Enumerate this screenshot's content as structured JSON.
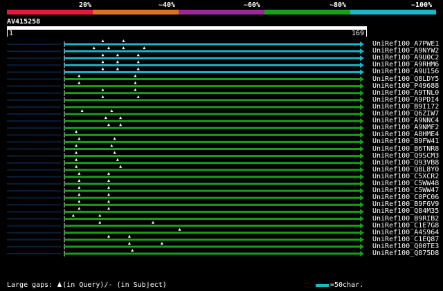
{
  "legend": {
    "segments": [
      {
        "label": "20%",
        "color": "#e8173c"
      },
      {
        "label": "~40%",
        "color": "#e07020"
      },
      {
        "label": "~60%",
        "color": "#9a2898"
      },
      {
        "label": "~80%",
        "color": "#18a018"
      },
      {
        "label": "~100%",
        "color": "#18b8c8"
      }
    ]
  },
  "query": {
    "id": "AV415258",
    "start": "1",
    "end": "169"
  },
  "hits": [
    {
      "name": "UniRef100_A7PWE1",
      "color": "#18b8c8",
      "markers": [
        0.13,
        0.2
      ]
    },
    {
      "name": "UniRef100_A9NYW2",
      "color": "#18b8c8",
      "markers": [
        0.1,
        0.15,
        0.2,
        0.27
      ]
    },
    {
      "name": "UniRef100_A9U0C2",
      "color": "#18b8c8",
      "markers": [
        0.13,
        0.18,
        0.25
      ]
    },
    {
      "name": "UniRef100_A9RHM6",
      "color": "#18b8c8",
      "markers": [
        0.13,
        0.18,
        0.25
      ]
    },
    {
      "name": "UniRef100_A9U156",
      "color": "#18b8c8",
      "markers": [
        0.13,
        0.18,
        0.25
      ]
    },
    {
      "name": "UniRef100_Q8LDY5",
      "color": "#18a018",
      "markers": [
        0.05,
        0.24
      ]
    },
    {
      "name": "UniRef100_P49688",
      "color": "#18a018",
      "markers": [
        0.05,
        0.24
      ]
    },
    {
      "name": "UniRef100_A9TNL0",
      "color": "#18a018",
      "markers": [
        0.13,
        0.24
      ]
    },
    {
      "name": "UniRef100_A9PDI4",
      "color": "#18a018",
      "markers": [
        0.13,
        0.25
      ]
    },
    {
      "name": "UniRef100_B9I172",
      "color": "#18a018",
      "markers": []
    },
    {
      "name": "UniRef100_Q6ZIW7",
      "color": "#18a018",
      "markers": [
        0.06,
        0.16
      ]
    },
    {
      "name": "UniRef100_A9NNC4",
      "color": "#18a018",
      "markers": [
        0.14,
        0.19
      ]
    },
    {
      "name": "UniRef100_A9NMF2",
      "color": "#18a018",
      "markers": [
        0.15,
        0.19
      ]
    },
    {
      "name": "UniRef100_A8HME4",
      "color": "#18a018",
      "markers": [
        0.04
      ]
    },
    {
      "name": "UniRef100_B9FW41",
      "color": "#18a018",
      "markers": [
        0.05,
        0.17
      ]
    },
    {
      "name": "UniRef100_B6TNR8",
      "color": "#18a018",
      "markers": [
        0.04,
        0.16
      ]
    },
    {
      "name": "UniRef100_Q9SCM3",
      "color": "#18a018",
      "markers": [
        0.04,
        0.17
      ]
    },
    {
      "name": "UniRef100_Q93VB8",
      "color": "#18a018",
      "markers": [
        0.04,
        0.18
      ]
    },
    {
      "name": "UniRef100_Q8L8Y0",
      "color": "#18a018",
      "markers": [
        0.04,
        0.19
      ]
    },
    {
      "name": "UniRef100_C5XCR2",
      "color": "#18a018",
      "markers": [
        0.05,
        0.15
      ]
    },
    {
      "name": "UniRef100_C5WW48",
      "color": "#18a018",
      "markers": [
        0.05,
        0.15
      ]
    },
    {
      "name": "UniRef100_C5WW47",
      "color": "#18a018",
      "markers": [
        0.05,
        0.15
      ]
    },
    {
      "name": "UniRef100_C0PC06",
      "color": "#18a018",
      "markers": [
        0.05,
        0.15
      ]
    },
    {
      "name": "UniRef100_B9F6V9",
      "color": "#18a018",
      "markers": [
        0.05,
        0.15
      ]
    },
    {
      "name": "UniRef100_Q84M35",
      "color": "#18a018",
      "markers": [
        0.05,
        0.15
      ]
    },
    {
      "name": "UniRef100_B9RIB2",
      "color": "#18a018",
      "markers": [
        0.03,
        0.12
      ]
    },
    {
      "name": "UniRef100_C1E7G8",
      "color": "#18a018",
      "markers": [
        0.12,
        0.3
      ]
    },
    {
      "name": "UniRef100_A4S964",
      "color": "#18a018",
      "markers": [
        0.39
      ]
    },
    {
      "name": "UniRef100_C1EQ87",
      "color": "#18a018",
      "markers": [
        0.15,
        0.22
      ]
    },
    {
      "name": "UniRef100_Q00TE3",
      "color": "#18a018",
      "markers": [
        0.22,
        0.33
      ]
    },
    {
      "name": "UniRef100_Q875D8",
      "color": "#18a018",
      "markers": [
        0.23
      ]
    }
  ],
  "footer": {
    "gaps_prefix": "Large gaps: ",
    "query_gap": "(in Query)/",
    "dash": "-",
    "subject_gap": " (in Subject)",
    "scale_label": "=50char."
  }
}
